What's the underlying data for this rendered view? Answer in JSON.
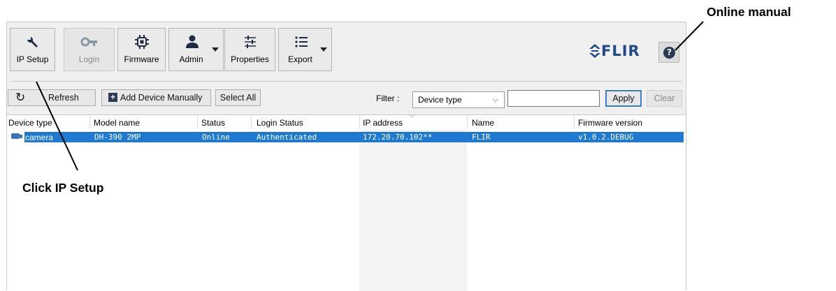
{
  "toolbar": {
    "buttons": [
      {
        "label": "IP Setup",
        "icon": "wrench-icon",
        "enabled": true
      },
      {
        "label": "Login",
        "icon": "key-icon",
        "enabled": false
      },
      {
        "label": "Firmware",
        "icon": "chip-icon",
        "enabled": true
      },
      {
        "label": "Admin",
        "icon": "user-icon",
        "enabled": true,
        "dropdown": true
      },
      {
        "label": "Properties",
        "icon": "sliders-icon",
        "enabled": true
      },
      {
        "label": "Export",
        "icon": "list-icon",
        "enabled": true,
        "dropdown": true
      }
    ],
    "brand": "FLIR",
    "help_icon": "question-icon"
  },
  "actions": {
    "refresh": "Refresh",
    "add_device": "Add Device Manually",
    "select_all": "Select All",
    "filter_label": "Filter :",
    "filter_value": "Device type",
    "apply": "Apply",
    "clear": "Clear"
  },
  "table": {
    "columns": [
      "Device type",
      "Model name",
      "Status",
      "Login Status",
      "IP address",
      "Name",
      "Firmware version"
    ],
    "rows": [
      {
        "device_type": "camera",
        "model_name": "DH-390 2MP",
        "status": "Online",
        "login_status": "Authenticated",
        "ip_address": "172.20.70.102**",
        "name": "FLIR",
        "firmware_version": "v1.0.2.DEBUG"
      }
    ]
  },
  "annotations": {
    "online_manual": "Online manual",
    "click_ip_setup": "Click IP Setup"
  },
  "colors": {
    "selection": "#1d7ad0",
    "window_bg": "#f0f0f0",
    "apply_border": "#3c7fc4"
  }
}
